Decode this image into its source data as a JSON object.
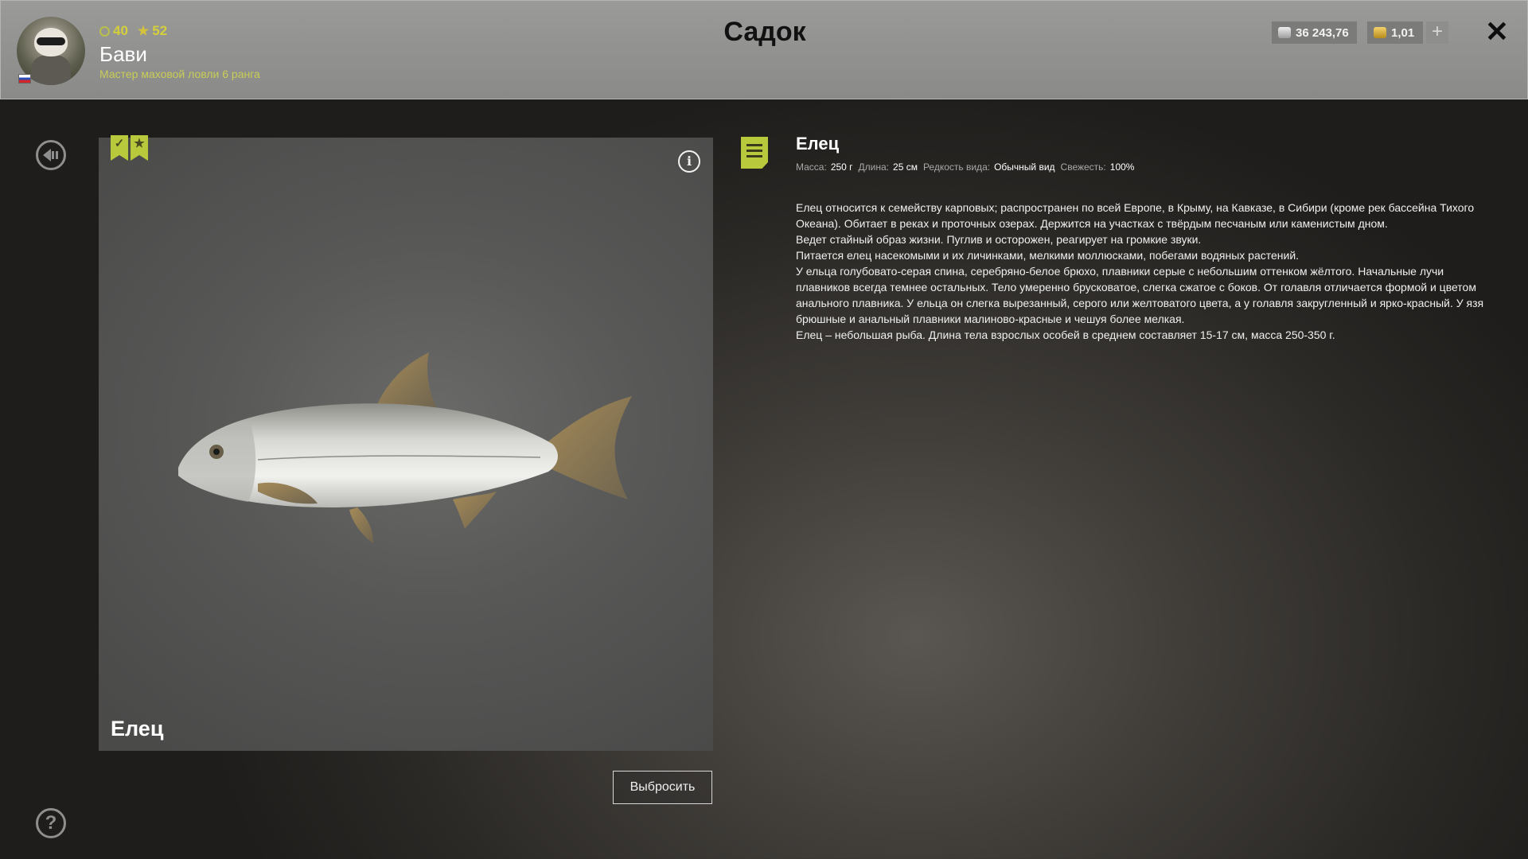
{
  "player": {
    "rating": "40",
    "stars": "52",
    "name": "Бави",
    "rank": "Мастер маховой ловли 6 ранга"
  },
  "header": {
    "title": "Садок"
  },
  "currency": {
    "silver": "36 243,76",
    "gold": "1,01",
    "add_label": "+"
  },
  "fish": {
    "name": "Елец",
    "caption": "Елец",
    "meta": {
      "mass_label": "Масса:",
      "mass_value": "250 г",
      "length_label": "Длина:",
      "length_value": "25 см",
      "rarity_label": "Редкость вида:",
      "rarity_value": "Обычный вид",
      "freshness_label": "Свежесть:",
      "freshness_value": "100%"
    },
    "description": [
      "Елец относится к семейству карповых; распространен по всей Европе, в Крыму, на Кавказе, в Сибири (кроме рек бассейна Тихого Океана). Обитает в реках и проточных озерах. Держится на участках с твёрдым песчаным или каменистым дном.",
      "Ведет стайный образ жизни. Пуглив и осторожен, реагирует на громкие звуки.",
      "Питается елец насекомыми и их личинками, мелкими моллюсками, побегами водяных растений.",
      "У ельца голубовато-серая спина, серебряно-белое брюхо, плавники серые с небольшим оттенком жёлтого. Начальные лучи плавников всегда темнее остальных. Тело умеренно брусковатое, слегка сжатое с боков. От голавля отличается формой и цветом анального плавника. У ельца он слегка вырезанный, серого или желтоватого цвета, а у голавля закругленный и ярко-красный. У язя брюшные и анальный плавники малиново-красные и чешуя более мелкая.",
      "Елец – небольшая рыба. Длина тела взрослых особей в среднем составляет 15-17 см, масса 250-350 г."
    ]
  },
  "actions": {
    "discard_label": "Выбросить",
    "help_label": "?",
    "info_label": "i",
    "close_label": "✕"
  },
  "colors": {
    "accent": "#b9c93c",
    "topbar": "#8a8a89",
    "rank_text": "#c9cd55"
  }
}
